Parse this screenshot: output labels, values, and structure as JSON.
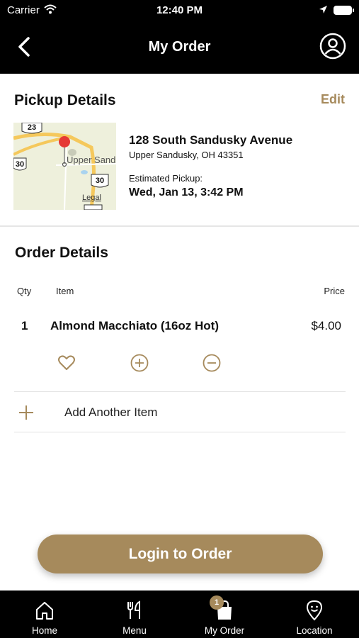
{
  "status_bar": {
    "carrier": "Carrier",
    "time": "12:40 PM",
    "icons": [
      "wifi-icon",
      "location-arrow-icon",
      "battery-icon"
    ]
  },
  "nav_bar": {
    "title": "My Order",
    "icons": [
      "back-chevron-icon",
      "profile-icon"
    ]
  },
  "pickup": {
    "title": "Pickup Details",
    "edit_label": "Edit",
    "address_line1": "128 South Sandusky Avenue",
    "address_line2": "Upper Sandusky, OH 43351",
    "estimated_label": "Estimated Pickup:",
    "estimated_value": "Wed, Jan 13, 3:42 PM",
    "map": {
      "labels": [
        "23",
        "30",
        "Upper Sand",
        "30",
        "Legal"
      ]
    }
  },
  "order": {
    "title": "Order Details",
    "columns": {
      "qty": "Qty",
      "item": "Item",
      "price": "Price"
    },
    "items": [
      {
        "qty": "1",
        "name": "Almond Macchiato (16oz Hot)",
        "price": "$4.00"
      }
    ],
    "item_actions": [
      "heart-icon",
      "plus-circle-icon",
      "minus-circle-icon"
    ],
    "add_item_label": "Add Another Item"
  },
  "login_button": {
    "label": "Login to Order"
  },
  "tab_bar": {
    "tabs": [
      {
        "label": "Home",
        "icon": "home-icon"
      },
      {
        "label": "Menu",
        "icon": "fork-knife-icon"
      },
      {
        "label": "My Order",
        "icon": "shopping-bag-icon"
      },
      {
        "label": "Location",
        "icon": "location-pin-icon"
      }
    ],
    "cart_badge": "1"
  },
  "colors": {
    "accent": "#a68a5c",
    "bar_background": "#000000",
    "map_pin": "#e53935"
  }
}
